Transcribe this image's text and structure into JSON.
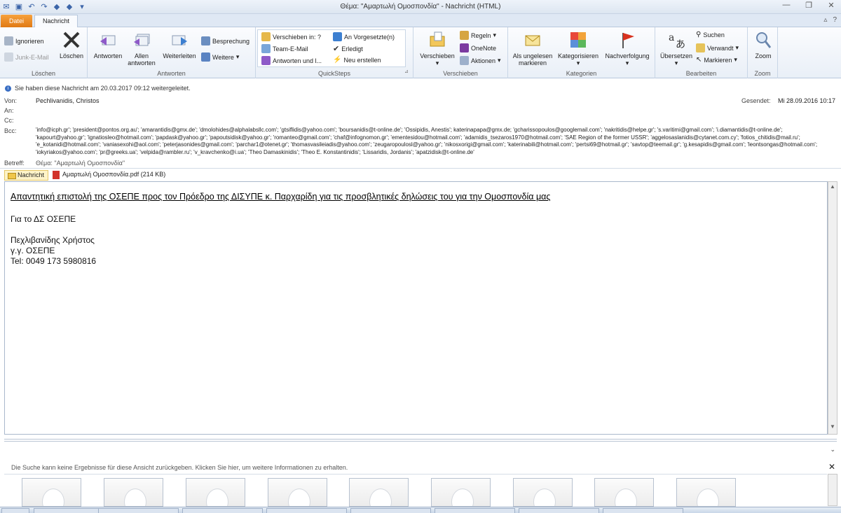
{
  "window": {
    "title": "Θέμα: \"Αμαρτωλή Ομοσπονδία\" - Nachricht (HTML)"
  },
  "tabs": {
    "file": "Datei",
    "message": "Nachricht"
  },
  "ribbon": {
    "groups": {
      "delete": {
        "label": "Löschen",
        "ignore": "Ignorieren",
        "junk": "Junk-E-Mail",
        "delete_btn": "Löschen"
      },
      "respond": {
        "label": "Antworten",
        "reply": "Antworten",
        "reply_all_1": "Allen",
        "reply_all_2": "antworten",
        "forward": "Weiterleiten",
        "meeting": "Besprechung",
        "more": "Weitere"
      },
      "quicksteps": {
        "label": "QuickSteps",
        "items": [
          "Verschieben in: ?",
          "Team-E-Mail",
          "Antworten und l...",
          "An Vorgesetzte(n)",
          "Erledigt",
          "Neu erstellen"
        ]
      },
      "move": {
        "label": "Verschieben",
        "move_btn": "Verschieben",
        "rules": "Regeln",
        "onenote": "OneNote",
        "actions": "Aktionen"
      },
      "tags": {
        "label": "Kategorien",
        "unread_1": "Als ungelesen",
        "unread_2": "markieren",
        "categorize": "Kategorisieren",
        "followup": "Nachverfolgung"
      },
      "editing": {
        "label": "Bearbeiten",
        "translate": "Übersetzen",
        "find": "Suchen",
        "related": "Verwandt",
        "select": "Markieren"
      },
      "zoom": {
        "label": "Zoom",
        "zoom_btn": "Zoom"
      }
    }
  },
  "header": {
    "info": "Sie haben diese Nachricht am 20.03.2017 09:12 weitergeleitet.",
    "from_label": "Von:",
    "from": "Pechlivanidis, Christos",
    "to_label": "An:",
    "cc_label": "Cc:",
    "bcc_label": "Bcc:",
    "bcc": "'info@icph.gr'; 'president@pontos.org.au'; 'amarantidis@gmx.de'; 'dmolohides@alphalabsllc.com'; 'gtsiflidis@yahoo.com'; 'boursanidis@t-online.de'; 'Ossipidis, Anestis'; katerinapapa@gmx.de; 'gcharissopoulos@googlemail.com'; 'nakritidis@helpe.gr'; 's.varitimi@gmail.com'; 'i.diamantidis@t-online.de'; 'kapourt@yahoo.gr'; 'ignatiosleo@hotmail.com'; 'papdask@yahoo.gr'; 'papoutsidisk@yahoo.gr'; 'romanteo@gmail.com'; 'chaf@infognomon.gr'; 'ementesidou@hotmail.com'; 'adamidis_tsezaros1970@hotmail.com'; 'SAE Region of the former USSR'; 'aggelosaslanidis@cytanet.com.cy'; 'fotios_chitidis@mail.ru'; 'e_kotanidi@hotmail.com'; 'vaniasexohi@aol.com'; 'peterjasonides@gmail.com'; 'parchar1@otenet.gr'; 'thomasvasileiadis@yahoo.com'; 'zeugaropoulosl@yahoo.gr'; 'nikosxorigi@gmail.com'; 'katerinabili@hotmail.com'; 'pertsi69@hotmail.gr'; 'savtop@teemail.gr'; 'g.kesapidis@gmail.com'; 'leontsongas@hotmail.com'; 'iokyriakos@yahoo.com'; 'pr@greeks.ua'; 'velpida@rambler.ru'; 'v_kravchenko@i.ua'; 'Theo Damaskinidis'; 'Theo E. Konstantinidis'; 'Lissaridis, Jordanis'; 'apatzidisk@t-online.de'",
    "subject_label": "Betreff:",
    "subject": "Θέμα: \"Αμαρτωλή Ομοσπονδία\"",
    "sent_label": "Gesendet:",
    "sent": "Mi 28.09.2016 10:17"
  },
  "attachments": {
    "message": "Nachricht",
    "pdf": "Αμαρτωλή Ομοσπονδία.pdf (214 KB)"
  },
  "body": {
    "heading": "Απαντητική επιστολή της ΟΣΕΠΕ προς τον Πρόεδρο της ΔΙΣΥΠΕ κ. Παρχαρίδη για τις προσβλητικές δηλώσεις του για την Ομοσπονδία μας",
    "line1": "Για το ΔΣ ΟΣΕΠΕ",
    "sig_name": "Πεχλιβανίδης Χρήστος",
    "sig_role": "γ.γ. ΟΣΕΠΕ",
    "sig_tel": "Tel: 0049 173 5980816"
  },
  "people_pane": {
    "message": "Die Suche kann keine Ergebnisse für diese Ansicht zurückgeben. Klicken Sie hier, um weitere Informationen zu erhalten."
  },
  "colors": {
    "file_tab": "#e57f18",
    "accent": "#3b6fc4"
  },
  "icons": [
    "save-icon",
    "undo-icon",
    "redo-icon",
    "up-icon",
    "down-icon",
    "minimize-icon",
    "restore-icon",
    "close-icon",
    "help-icon",
    "info-icon",
    "envelope-icon",
    "pdf-icon",
    "avatar-icon"
  ]
}
